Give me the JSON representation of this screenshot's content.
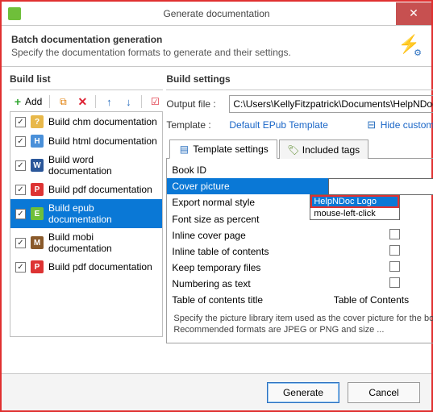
{
  "window": {
    "title": "Generate documentation"
  },
  "header": {
    "title": "Batch documentation generation",
    "subtitle": "Specify the documentation formats to generate and their settings."
  },
  "buildlist": {
    "title": "Build list",
    "add_label": "Add",
    "items": [
      {
        "label": "Build chm documentation",
        "icon": "chm",
        "checked": true
      },
      {
        "label": "Build html documentation",
        "icon": "html",
        "checked": true
      },
      {
        "label": "Build word documentation",
        "icon": "word",
        "checked": true
      },
      {
        "label": "Build pdf documentation",
        "icon": "pdf",
        "checked": true
      },
      {
        "label": "Build epub documentation",
        "icon": "epub",
        "checked": true,
        "selected": true
      },
      {
        "label": "Build mobi documentation",
        "icon": "mobi",
        "checked": true
      },
      {
        "label": "Build pdf documentation",
        "icon": "pdf",
        "checked": true
      }
    ]
  },
  "settings": {
    "title": "Build settings",
    "output_label": "Output file :",
    "output_path": "C:\\Users\\KellyFitzpatrick\\Documents\\HelpNDoc",
    "template_label": "Template :",
    "template_value": "Default EPub Template",
    "hide_customization": "Hide customization",
    "tabs": {
      "template": "Template settings",
      "included": "Included tags"
    },
    "rows": {
      "book_id": "Book ID",
      "cover_picture": "Cover picture",
      "export_normal": "Export normal style",
      "font_size": "Font size as percent",
      "inline_cover": "Inline cover page",
      "inline_toc": "Inline table of contents",
      "keep_temp": "Keep temporary files",
      "numbering": "Numbering as text",
      "toc_title": "Table of contents title",
      "toc_title_val": "Table of Contents"
    },
    "dropdown": {
      "opt1": "HelpNDoc Logo",
      "opt2": "mouse-left-click"
    },
    "hint": "Specify the picture library item used as the cover picture for the book. Recommended formats are JPEG or PNG and size ..."
  },
  "footer": {
    "generate": "Generate",
    "cancel": "Cancel"
  }
}
